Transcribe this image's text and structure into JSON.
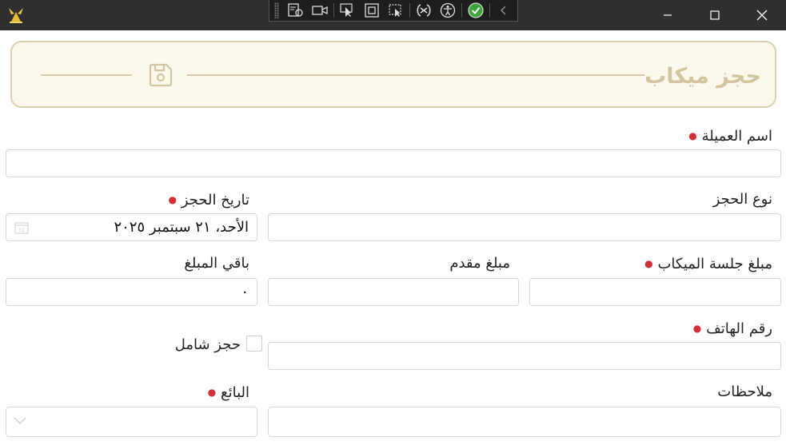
{
  "window": {
    "minimize_icon": "minimize-icon",
    "maximize_icon": "maximize-icon",
    "close_icon": "close-icon"
  },
  "devtools": {
    "icons": [
      "live-visual-tree-icon",
      "video-camera-icon",
      "select-element-icon",
      "display-layout-adorners-icon",
      "track-focus-icon",
      "binding-failures-icon",
      "accessibility-icon",
      "accessibility-checker-icon",
      "collapse-icon"
    ]
  },
  "header": {
    "title": "حجز ميكاب",
    "icon": "save-icon",
    "colors": {
      "background": "#fdf8ec",
      "border": "#d9ceae",
      "text": "#d2c4a0"
    }
  },
  "form": {
    "customer_name": {
      "label": "اسم العميلة",
      "required": true,
      "value": ""
    },
    "booking_type": {
      "label": "نوع الحجز",
      "required": false,
      "value": ""
    },
    "booking_date": {
      "label": "تاريخ الحجز",
      "required": true,
      "value": "الأحد، ٢١ سبتمبر ٢٠٢٥"
    },
    "session_amount": {
      "label": "مبلغ جلسة الميكاب",
      "required": true,
      "value": ""
    },
    "down_payment": {
      "label": "مبلغ مقدم",
      "required": false,
      "value": ""
    },
    "remaining_amount": {
      "label": "باقي المبلغ",
      "required": false,
      "value": "٠"
    },
    "phone": {
      "label": "رقم الهاتف",
      "required": true,
      "value": ""
    },
    "full_booking": {
      "label": "حجز شامل",
      "checked": false
    },
    "notes": {
      "label": "ملاحظات",
      "required": false,
      "value": ""
    },
    "seller": {
      "label": "البائع",
      "required": true,
      "value": ""
    }
  },
  "colors": {
    "required_dot": "#d32f3a",
    "titlebar": "#2f2f2f"
  }
}
